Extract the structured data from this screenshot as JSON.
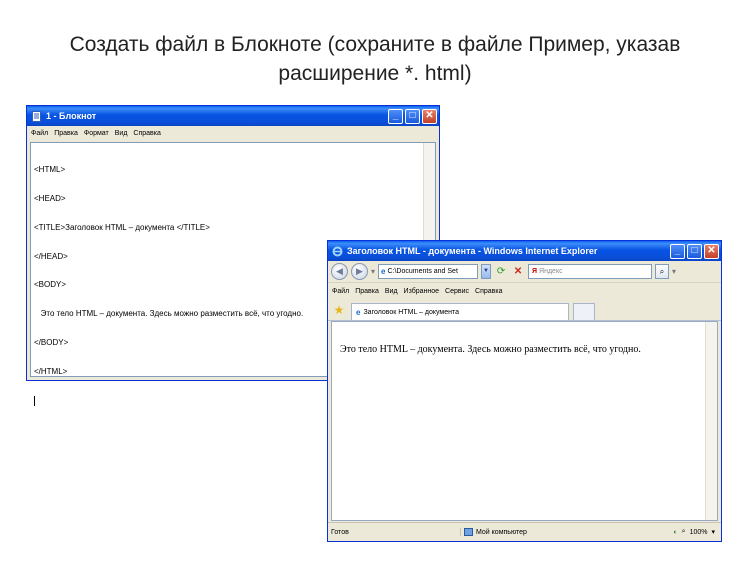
{
  "slide": {
    "title_line1": "Создать файл в Блокноте (сохраните в файле  Пример,  указав",
    "title_line2": "расширение  *. html)"
  },
  "notepad": {
    "title": "1 - Блокнот",
    "menu": [
      "Файл",
      "Правка",
      "Формат",
      "Вид",
      "Справка"
    ],
    "code_lines": [
      "<HTML>",
      "<HEAD>",
      "<TITLE>Заголовок HTML – документа </TITLE>",
      "</HEAD>",
      "<BODY>",
      "   Это тело HTML – документа. Здесь можно разместить всё, что угодно.",
      "</BODY>",
      "</HTML>"
    ]
  },
  "ie": {
    "title": "Заголовок HTML - документа - Windows Internet Explorer",
    "address": "C:\\Documents and Set",
    "search_placeholder": "Яндекс",
    "menu": [
      "Файл",
      "Правка",
      "Вид",
      "Избранное",
      "Сервис",
      "Справка"
    ],
    "tab_label": "Заголовок HTML – документа",
    "body_text": "Это тело HTML – документа. Здесь можно разместить всё, что угодно.",
    "status": {
      "ready": "Готов",
      "zone": "Мой компьютер",
      "zoom": "100%"
    }
  },
  "colors": {
    "xp_title_blue": "#0a4fda",
    "xp_face": "#ece9d8",
    "close_red": "#c1412a"
  },
  "icons": {
    "notepad": "notepad-icon",
    "ie": "ie-icon",
    "back": "back-arrow-icon",
    "forward": "forward-arrow-icon",
    "refresh": "refresh-icon",
    "stop": "stop-icon",
    "search": "search-icon",
    "favorites": "favorites-star-icon",
    "computer": "my-computer-icon"
  }
}
